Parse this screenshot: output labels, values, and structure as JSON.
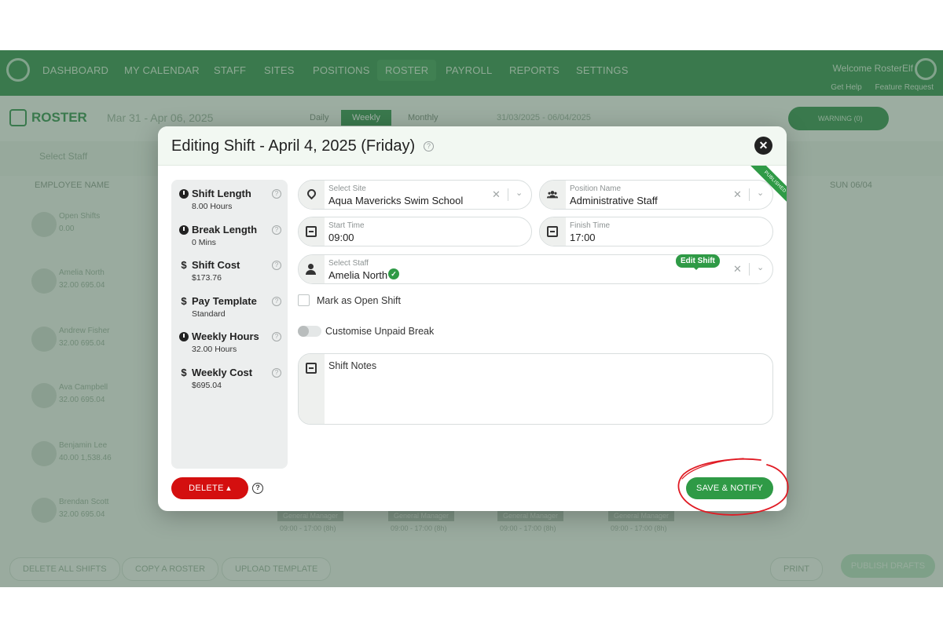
{
  "nav": {
    "items": [
      "DASHBOARD",
      "MY CALENDAR",
      "STAFF",
      "SITES",
      "POSITIONS",
      "ROSTER",
      "PAYROLL",
      "REPORTS",
      "SETTINGS"
    ],
    "welcome": "Welcome RosterElf",
    "get_help": "Get Help",
    "feature_request": "Feature Request"
  },
  "toolbar": {
    "title": "ROSTER",
    "range": "Mar 31 - Apr 06, 2025",
    "views": [
      "Daily",
      "Weekly",
      "Monthly"
    ],
    "date_range": "31/03/2025 - 06/04/2025",
    "warning": "WARNING (0)",
    "warning_count": "0"
  },
  "filter": {
    "select_staff": "Select Staff"
  },
  "grid": {
    "employee_header": "EMPLOYEE NAME",
    "sun_header": "SUN 06/04",
    "employees": [
      {
        "name": "Open Shifts",
        "stats": "0.00"
      },
      {
        "name": "Amelia North",
        "stats": "32.00   695.04"
      },
      {
        "name": "Andrew Fisher",
        "stats": "32.00   695.04"
      },
      {
        "name": "Ava Campbell",
        "stats": "32.00   695.04"
      },
      {
        "name": "Benjamin Lee",
        "stats": "40.00   1,538.46"
      },
      {
        "name": "Brendan Scott",
        "stats": "32.00   695.04"
      }
    ],
    "shift_label": "General Manager",
    "shift_time": "09:00 - 17:00 (8h)"
  },
  "bottom": {
    "delete_all": "DELETE ALL SHIFTS",
    "copy_roster": "COPY A ROSTER",
    "upload_template": "UPLOAD TEMPLATE",
    "print": "PRINT",
    "publish": "PUBLISH DRAFTS"
  },
  "modal": {
    "title": "Editing Shift - April 4, 2025 (Friday)",
    "ribbon": "PUBLISHED",
    "summary": [
      {
        "icon": "clock-icon",
        "label": "Shift Length",
        "value": "8.00 Hours"
      },
      {
        "icon": "clock-icon",
        "label": "Break Length",
        "value": "0 Mins"
      },
      {
        "icon": "dollar-icon",
        "label": "Shift Cost",
        "value": "$173.76"
      },
      {
        "icon": "dollar-icon",
        "label": "Pay Template",
        "value": "Standard"
      },
      {
        "icon": "clock-icon",
        "label": "Weekly Hours",
        "value": "32.00 Hours"
      },
      {
        "icon": "dollar-icon",
        "label": "Weekly Cost",
        "value": "$695.04"
      }
    ],
    "site": {
      "label": "Select Site",
      "value": "Aqua Mavericks Swim School"
    },
    "position": {
      "label": "Position Name",
      "value": "Administrative Staff"
    },
    "start_time": {
      "label": "Start Time",
      "value": "09:00"
    },
    "finish_time": {
      "label": "Finish Time",
      "value": "17:00"
    },
    "staff": {
      "label": "Select Staff",
      "value": "Amelia North"
    },
    "edit_shift_tip": "Edit Shift",
    "open_shift_label": "Mark as Open Shift",
    "unpaid_break_label": "Customise Unpaid Break",
    "notes_placeholder": "Shift Notes",
    "delete_label": "DELETE",
    "save_label": "SAVE & NOTIFY"
  },
  "colors": {
    "brand_green": "#2f9a46",
    "delete_red": "#d40f0f",
    "annotation_red": "#e01b24"
  }
}
